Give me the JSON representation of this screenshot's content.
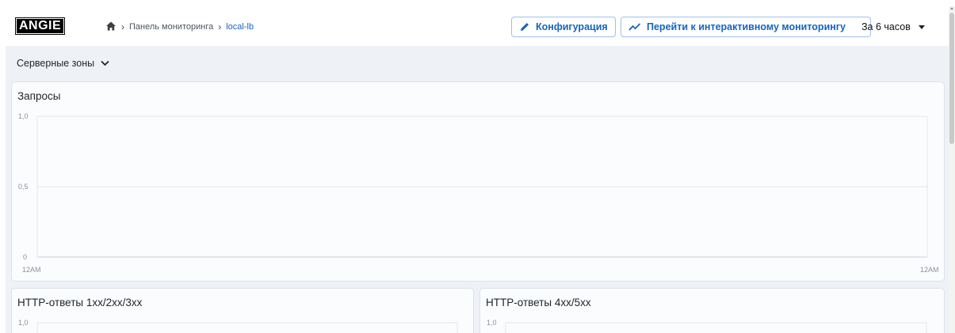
{
  "header": {
    "logo": "ANGIE",
    "breadcrumb": {
      "home_icon": "home-icon",
      "items": [
        "Панель мониторинга",
        "local-lb"
      ]
    },
    "config_button": {
      "label": "Конфигурация",
      "icon": "pencil-icon"
    },
    "monitor_button": {
      "label": "Перейти к интерактивному мониторингу",
      "icon": "trend-line-icon"
    },
    "time_range": {
      "selected": "За 6 часов"
    }
  },
  "zones_selector": {
    "label": "Серверные зоны"
  },
  "colors": {
    "accent": "#1565c0",
    "grid": "#e3e7ec",
    "background": "#eef1f5"
  },
  "chart_data": [
    {
      "type": "line",
      "title": "Запросы",
      "x_tick_labels": [
        "12AM",
        "12AM"
      ],
      "y_tick_labels": [
        "1,0",
        "0,5",
        "0"
      ],
      "ylim": [
        0,
        1
      ],
      "grid": true,
      "series": []
    },
    {
      "type": "line",
      "title": "HTTP-ответы 1xx/2xx/3xx",
      "y_tick_labels": [
        "1,0"
      ],
      "grid": true,
      "series": []
    },
    {
      "type": "line",
      "title": "HTTP-ответы 4xx/5xx",
      "y_tick_labels": [
        "1,0"
      ],
      "grid": true,
      "series": []
    }
  ]
}
